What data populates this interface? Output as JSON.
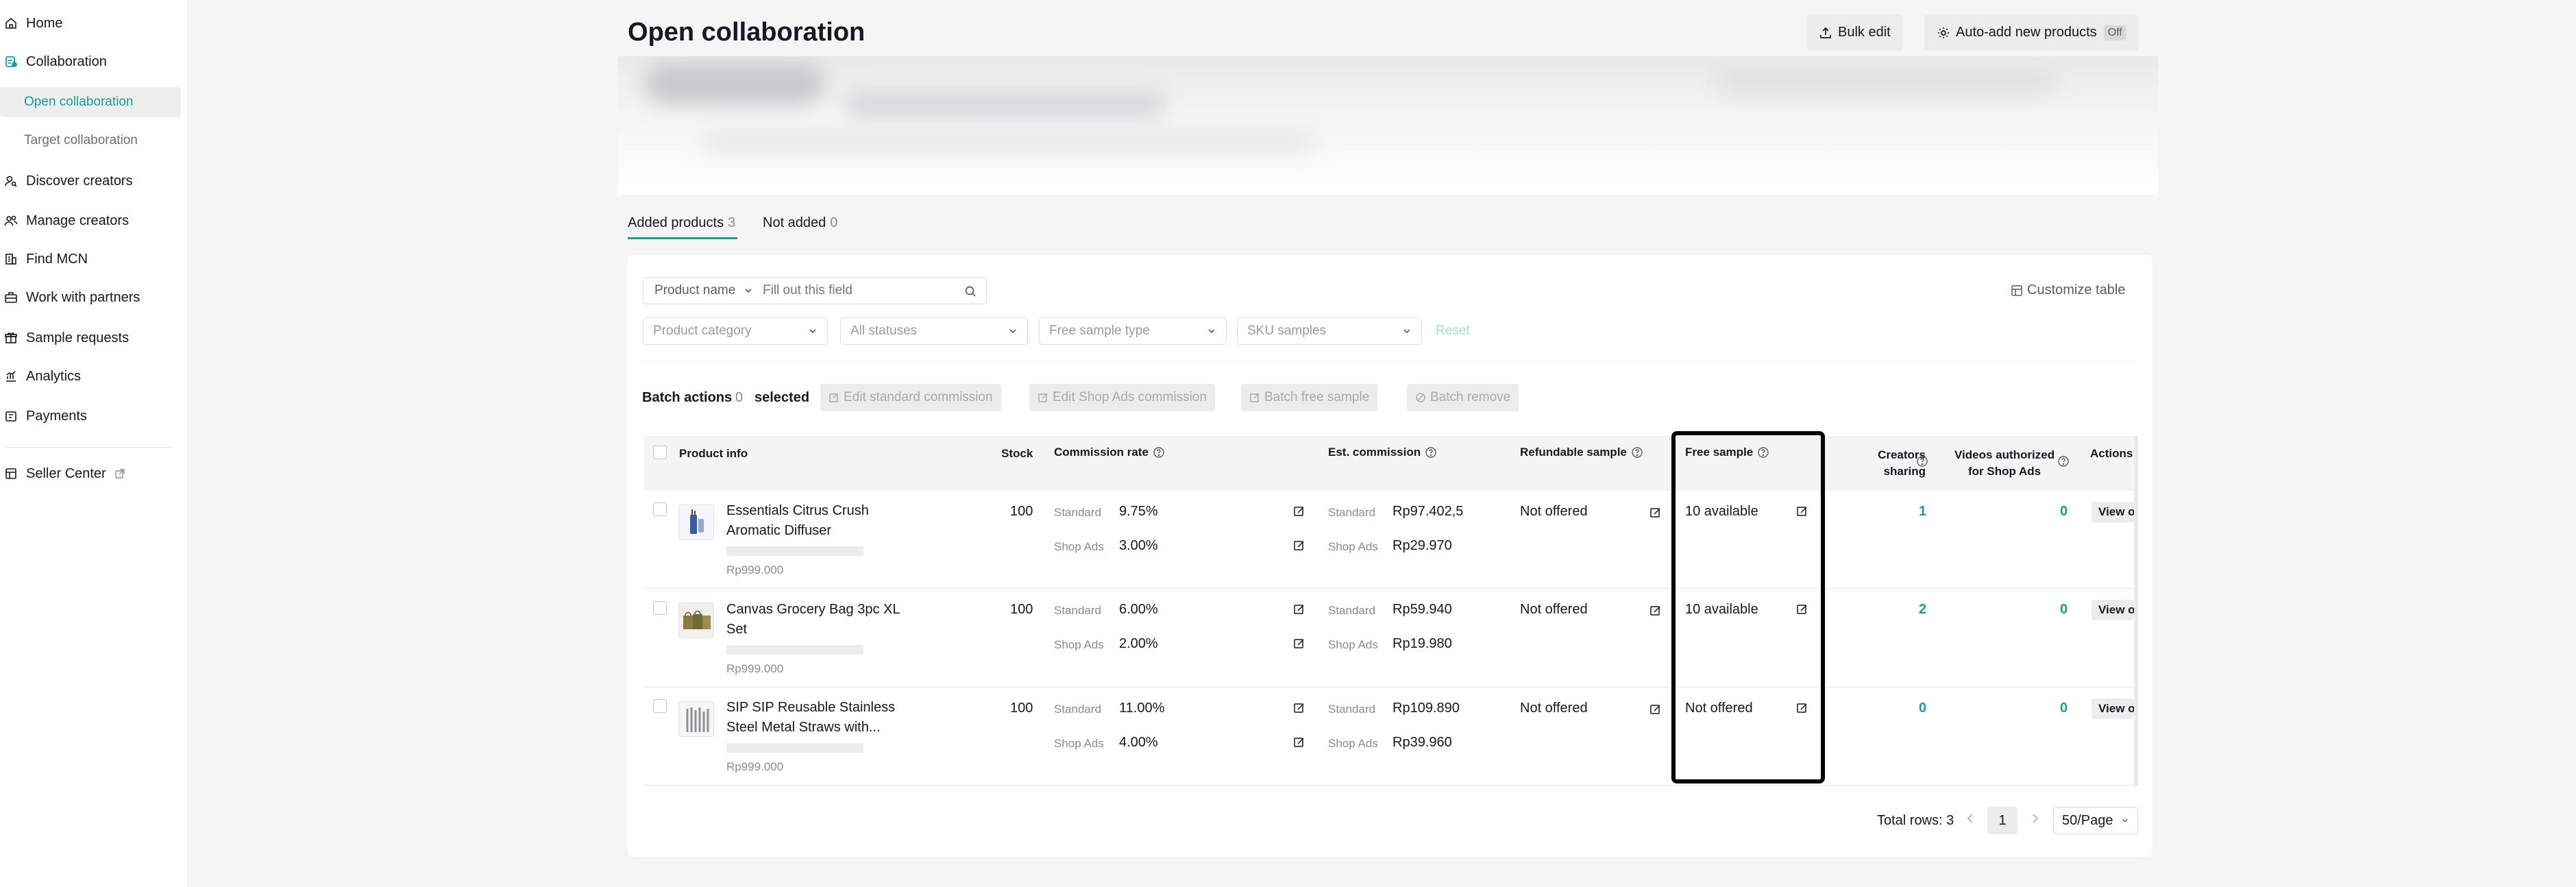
{
  "sidebar": {
    "items": [
      {
        "label": "Home",
        "icon": "home-icon"
      },
      {
        "label": "Collaboration",
        "icon": "collaboration-icon"
      },
      {
        "label": "Open collaboration"
      },
      {
        "label": "Target collaboration"
      },
      {
        "label": "Discover creators",
        "icon": "discover-icon"
      },
      {
        "label": "Manage creators",
        "icon": "users-icon"
      },
      {
        "label": "Find MCN",
        "icon": "building-icon"
      },
      {
        "label": "Work with partners",
        "icon": "partners-icon"
      },
      {
        "label": "Sample requests",
        "icon": "gift-icon"
      },
      {
        "label": "Analytics",
        "icon": "chart-icon"
      },
      {
        "label": "Payments",
        "icon": "wallet-icon"
      },
      {
        "label": "Seller Center",
        "icon": "store-icon"
      }
    ]
  },
  "header": {
    "title": "Open collaboration",
    "bulk_edit": "Bulk edit",
    "auto_add": "Auto-add new products",
    "auto_add_state": "Off"
  },
  "tabs": [
    {
      "label": "Added products",
      "count": "3"
    },
    {
      "label": "Not added",
      "count": "0"
    }
  ],
  "filters": {
    "product_select": "Product name",
    "search_placeholder": "Fill out this field",
    "category": "Product category",
    "statuses": "All statuses",
    "free_sample_type": "Free sample type",
    "sku_samples": "SKU samples",
    "reset": "Reset",
    "customize": "Customize table"
  },
  "batch": {
    "label": "Batch actions",
    "count": "0",
    "selected": "selected",
    "edit_standard": "Edit standard commission",
    "edit_shop_ads": "Edit Shop Ads commission",
    "batch_free_sample": "Batch free sample",
    "batch_remove": "Batch remove"
  },
  "table": {
    "headers": {
      "product_info": "Product info",
      "stock": "Stock",
      "commission_rate": "Commission rate",
      "est_commission": "Est. commission",
      "refundable_sample": "Refundable sample",
      "free_sample": "Free sample",
      "creators_sharing_1": "Creators",
      "creators_sharing_2": "sharing",
      "videos_auth_1": "Videos authorized",
      "videos_auth_2": "for Shop Ads",
      "actions": "Actions"
    },
    "labels": {
      "standard": "Standard",
      "shop_ads": "Shop Ads",
      "view": "View on"
    },
    "rows": [
      {
        "name_line1": "Essentials Citrus Crush",
        "name_line2": "Aromatic Diffuser",
        "price": "Rp999.000",
        "stock": "100",
        "rate_standard": "9.75%",
        "rate_shop_ads": "3.00%",
        "est_standard": "Rp97.402,5",
        "est_shop_ads": "Rp29.970",
        "refundable": "Not offered",
        "free_sample": "10 available",
        "creators": "1",
        "videos": "0"
      },
      {
        "name_line1": "Canvas Grocery Bag 3pc XL",
        "name_line2": "Set",
        "price": "Rp999.000",
        "stock": "100",
        "rate_standard": "6.00%",
        "rate_shop_ads": "2.00%",
        "est_standard": "Rp59.940",
        "est_shop_ads": "Rp19.980",
        "refundable": "Not offered",
        "free_sample": "10 available",
        "creators": "2",
        "videos": "0"
      },
      {
        "name_line1": "SIP SIP Reusable Stainless",
        "name_line2": "Steel Metal Straws with...",
        "price": "Rp999.000",
        "stock": "100",
        "rate_standard": "11.00%",
        "rate_shop_ads": "4.00%",
        "est_standard": "Rp109.890",
        "est_shop_ads": "Rp39.960",
        "refundable": "Not offered",
        "free_sample": "Not offered",
        "creators": "0",
        "videos": "0"
      }
    ]
  },
  "pagination": {
    "total": "Total rows: 3",
    "current": "1",
    "page_size": "50/Page"
  },
  "colors": {
    "accent": "#1a9c9a"
  }
}
